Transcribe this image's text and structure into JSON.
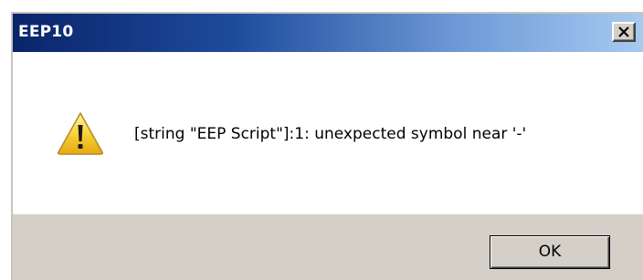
{
  "window": {
    "title": "EEP10"
  },
  "dialog": {
    "icon": "warning-icon",
    "message": "[string \"EEP Script\"]:1: unexpected symbol near '-'",
    "ok_label": "OK"
  },
  "colors": {
    "titlebar_start": "#0a246a",
    "titlebar_end": "#a6caf0",
    "warning_yellow": "#f5c518",
    "button_face": "#d4d0c8"
  }
}
